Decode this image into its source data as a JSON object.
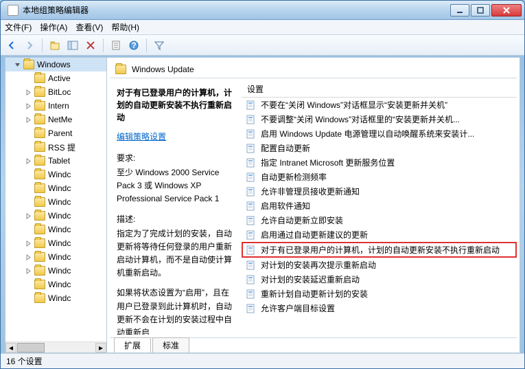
{
  "window": {
    "title": "本地组策略编辑器"
  },
  "menu": {
    "file": "文件(F)",
    "action": "操作(A)",
    "view": "查看(V)",
    "help": "帮助(H)"
  },
  "tree": {
    "items": [
      {
        "label": "Windows",
        "expanded": true,
        "sel": true,
        "indent": 0
      },
      {
        "label": "Active",
        "indent": 1
      },
      {
        "label": "BitLoc",
        "indent": 1,
        "hasChildren": true
      },
      {
        "label": "Intern",
        "indent": 1,
        "hasChildren": true
      },
      {
        "label": "NetMe",
        "indent": 1,
        "hasChildren": true
      },
      {
        "label": "Parent",
        "indent": 1
      },
      {
        "label": "RSS 提",
        "indent": 1
      },
      {
        "label": "Tablet",
        "indent": 1,
        "hasChildren": true
      },
      {
        "label": "Windc",
        "indent": 1
      },
      {
        "label": "Windc",
        "indent": 1
      },
      {
        "label": "Windc",
        "indent": 1
      },
      {
        "label": "Windc",
        "indent": 1,
        "hasChildren": true
      },
      {
        "label": "Windc",
        "indent": 1
      },
      {
        "label": "Windc",
        "indent": 1,
        "hasChildren": true
      },
      {
        "label": "Windc",
        "indent": 1,
        "hasChildren": true
      },
      {
        "label": "Windc",
        "indent": 1,
        "hasChildren": true
      },
      {
        "label": "Windc",
        "indent": 1
      },
      {
        "label": "Windc",
        "indent": 1
      }
    ]
  },
  "path": {
    "title": "Windows Update"
  },
  "desc": {
    "title": "对于有已登录用户的计算机，计划的自动更新安装不执行重新启动",
    "editLink": "编辑策略设置",
    "reqLabel": "要求:",
    "reqBody": "至少 Windows 2000 Service Pack 3 或 Windows XP Professional Service Pack 1",
    "descLabel": "描述:",
    "p1": "指定为了完成计划的安装，自动更新将等待任何登录的用户重新启动计算机，而不是自动使计算机重新启动。",
    "p2": "如果将状态设置为“启用”，且在用户已登录到此计算机时，自动更新不会在计划的安装过程中自动重新启"
  },
  "list": {
    "header": "设置",
    "rows": [
      {
        "text": "不要在“关闭 Windows”对话框显示“安装更新并关机”"
      },
      {
        "text": "不要调整“关闭 Windows”对话框里的“安装更新并关机..."
      },
      {
        "text": "启用 Windows Update 电源管理以自动唤醒系统来安装计..."
      },
      {
        "text": "配置自动更新"
      },
      {
        "text": "指定 Intranet Microsoft 更新服务位置"
      },
      {
        "text": "自动更新检测频率"
      },
      {
        "text": "允许非管理员接收更新通知"
      },
      {
        "text": "启用软件通知"
      },
      {
        "text": "允许自动更新立即安装"
      },
      {
        "text": "启用通过自动更新建议的更新"
      },
      {
        "text": "对于有已登录用户的计算机，计划的自动更新安装不执行重新启动",
        "highlight": true
      },
      {
        "text": "对计划的安装再次提示重新启动"
      },
      {
        "text": "对计划的安装延迟重新启动"
      },
      {
        "text": "重新计划自动更新计划的安装"
      },
      {
        "text": "允许客户端目标设置"
      }
    ]
  },
  "tabs": {
    "extended": "扩展",
    "standard": "标准"
  },
  "status": {
    "text": "16 个设置"
  }
}
